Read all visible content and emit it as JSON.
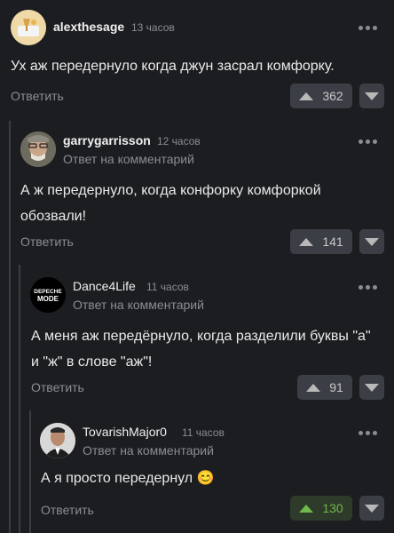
{
  "comments": [
    {
      "username": "alexthesage",
      "time": "13 часов",
      "subline": "",
      "text": "Ух аж передернуло когда джун засрал комфорку.",
      "reply_label": "Ответить",
      "rating": "362",
      "avatar_icon": "wine-glass-avatar"
    },
    {
      "username": "garrygarrisson",
      "time": "12 часов",
      "subline": "Ответ на комментарий",
      "text": "А ж передернуло, когда конфорку комфоркой обозвали!",
      "reply_label": "Ответить",
      "rating": "141",
      "avatar_icon": "person-avatar"
    },
    {
      "username": "Dance4Life",
      "time": "11 часов",
      "subline": "Ответ на комментарий",
      "text": "А меня аж передёрнуло, когда разделили буквы \"а\" и \"ж\" в слове \"аж\"!",
      "reply_label": "Ответить",
      "rating": "91",
      "avatar_icon": "depeche-mode-logo-avatar",
      "avatar_logo_line1": "DEPECHE",
      "avatar_logo_line2": "MODE"
    },
    {
      "username": "TovarishMajor0",
      "time": "11 часов",
      "subline": "Ответ на комментарий",
      "text": "А я просто передернул 😊",
      "reply_label": "Ответить",
      "rating": "130",
      "avatar_icon": "man-in-suit-avatar",
      "rating_color": "#6fb84a"
    }
  ]
}
